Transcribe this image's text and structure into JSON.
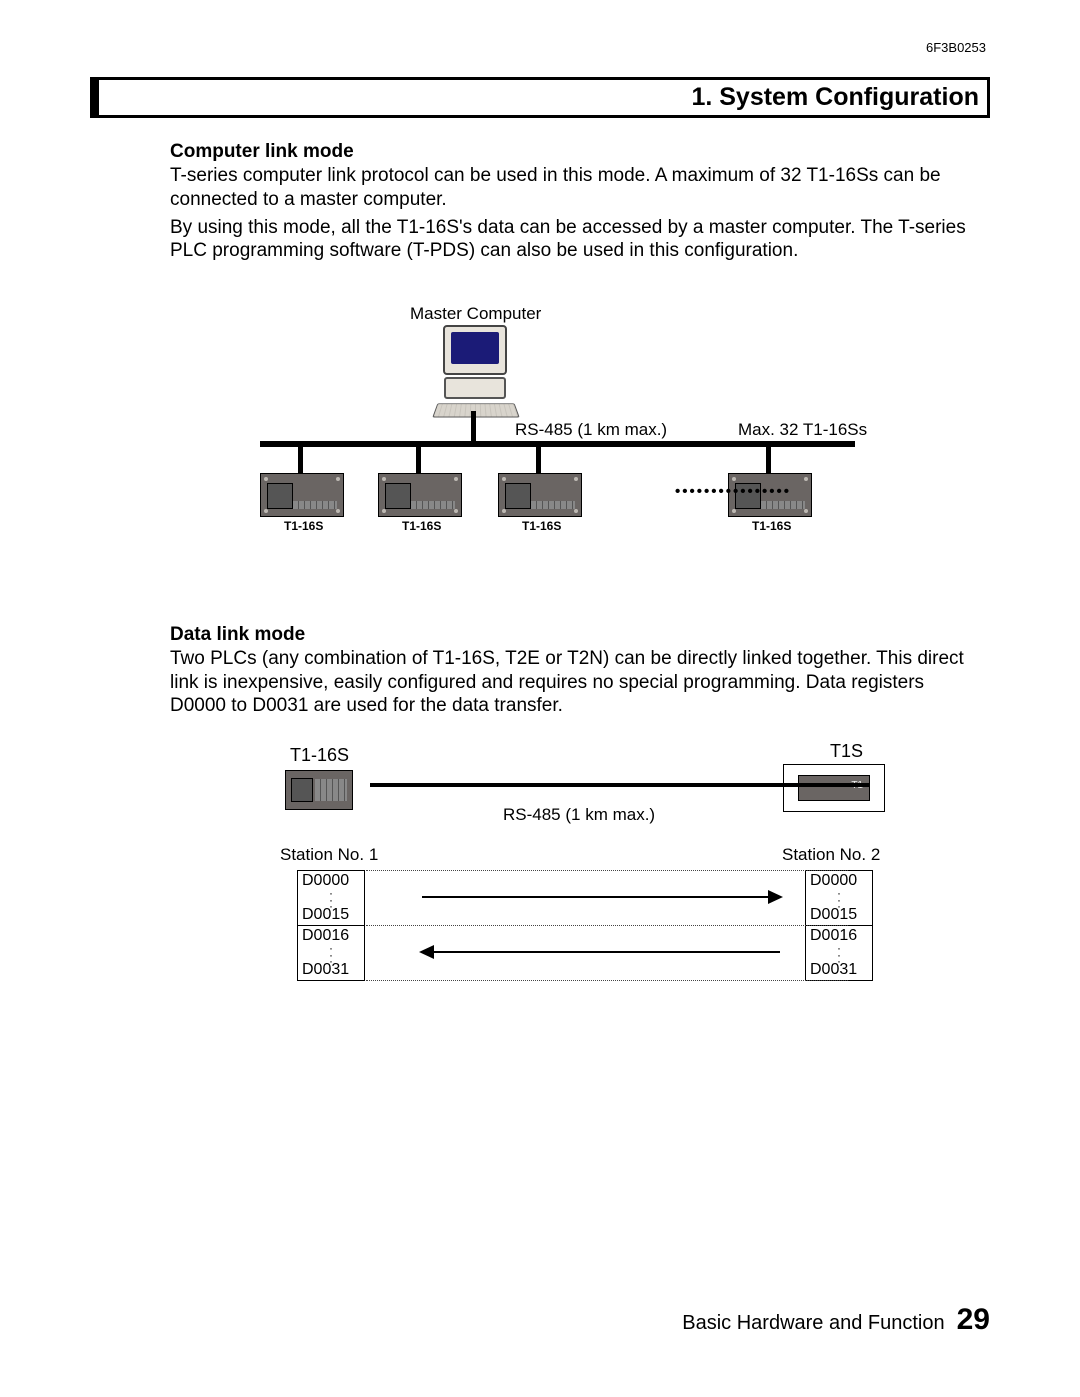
{
  "doc_id": "6F3B0253",
  "section_title": "1. System Configuration",
  "computer_link": {
    "heading": "Computer link mode",
    "p1": "T-series computer link protocol can be used in this mode. A maximum of 32 T1-16Ss can be connected to a master computer.",
    "p2": "By using this mode, all the T1-16S's data can be accessed by a master computer. The T-series PLC programming software (T-PDS) can also be used in this configuration.",
    "master_label": "Master Computer",
    "bus_label": "RS-485 (1 km max.)",
    "capacity_label": "Max. 32 T1-16Ss",
    "plc_label": "T1-16S"
  },
  "data_link": {
    "heading": "Data link mode",
    "p1": "Two PLCs (any combination of T1-16S, T2E or T2N) can be directly linked together. This direct link is inexpensive, easily configured and requires no special programming. Data registers D0000 to D0031 are used for the data transfer.",
    "left_label": "T1-16S",
    "right_label": "T1S",
    "right_inner": "T1",
    "bus_label": "RS-485 (1 km max.)",
    "station1": "Station No. 1",
    "station2": "Station No. 2",
    "registers": {
      "top_start": "D0000",
      "top_end": "D0015",
      "bot_start": "D0016",
      "bot_end": "D0031"
    }
  },
  "footer": {
    "text": "Basic Hardware and Function",
    "page": "29"
  }
}
